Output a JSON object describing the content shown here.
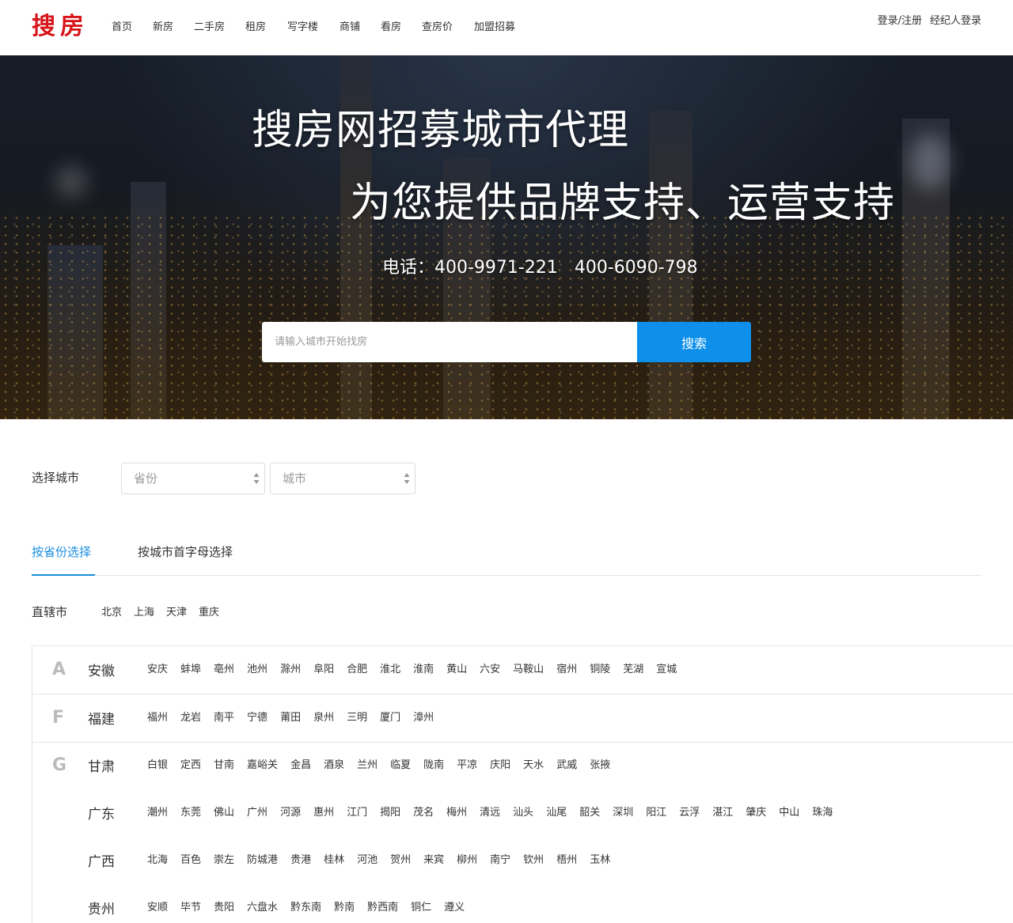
{
  "header": {
    "logo": "搜房",
    "nav": [
      "首页",
      "新房",
      "二手房",
      "租房",
      "写字楼",
      "商铺",
      "看房",
      "查房价",
      "加盟招募"
    ],
    "login": "登录/注册",
    "agent_login": "经纪人登录"
  },
  "hero": {
    "title1": "搜房网招募城市代理",
    "title2": "为您提供品牌支持、运营支持",
    "phone": "电话：400-9971-221   400-6090-798",
    "search_placeholder": "请输入城市开始找房",
    "search_button": "搜索"
  },
  "city_select": {
    "label": "选择城市",
    "province_placeholder": "省份",
    "city_placeholder": "城市"
  },
  "tabs": {
    "by_province": "按省份选择",
    "by_letter": "按城市首字母选择"
  },
  "municipalities": {
    "label": "直辖市",
    "cities": [
      "北京",
      "上海",
      "天津",
      "重庆"
    ]
  },
  "provinces": [
    {
      "letter": "A",
      "name": "安徽",
      "cities": [
        "安庆",
        "蚌埠",
        "亳州",
        "池州",
        "滁州",
        "阜阳",
        "合肥",
        "淮北",
        "淮南",
        "黄山",
        "六安",
        "马鞍山",
        "宿州",
        "铜陵",
        "芜湖",
        "宣城"
      ]
    },
    {
      "letter": "F",
      "name": "福建",
      "cities": [
        "福州",
        "龙岩",
        "南平",
        "宁德",
        "莆田",
        "泉州",
        "三明",
        "厦门",
        "漳州"
      ]
    },
    {
      "letter": "G",
      "name": "甘肃",
      "cities": [
        "白银",
        "定西",
        "甘南",
        "嘉峪关",
        "金昌",
        "酒泉",
        "兰州",
        "临夏",
        "陇南",
        "平凉",
        "庆阳",
        "天水",
        "武威",
        "张掖"
      ]
    },
    {
      "letter": "",
      "name": "广东",
      "cities": [
        "潮州",
        "东莞",
        "佛山",
        "广州",
        "河源",
        "惠州",
        "江门",
        "揭阳",
        "茂名",
        "梅州",
        "清远",
        "汕头",
        "汕尾",
        "韶关",
        "深圳",
        "阳江",
        "云浮",
        "湛江",
        "肇庆",
        "中山",
        "珠海"
      ]
    },
    {
      "letter": "",
      "name": "广西",
      "cities": [
        "北海",
        "百色",
        "崇左",
        "防城港",
        "贵港",
        "桂林",
        "河池",
        "贺州",
        "来宾",
        "柳州",
        "南宁",
        "钦州",
        "梧州",
        "玉林"
      ]
    },
    {
      "letter": "",
      "name": "贵州",
      "cities": [
        "安顺",
        "毕节",
        "贵阳",
        "六盘水",
        "黔东南",
        "黔南",
        "黔西南",
        "铜仁",
        "遵义"
      ]
    }
  ],
  "colors": {
    "brand_red": "#d7151a",
    "accent_blue": "#1a8ee0",
    "search_button_blue": "#0d8fea"
  }
}
